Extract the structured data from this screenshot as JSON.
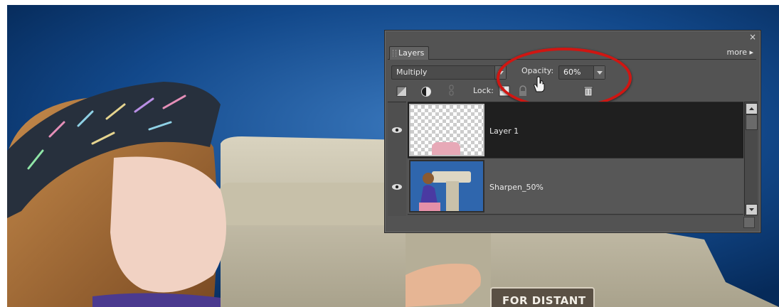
{
  "panel": {
    "close_glyph": "×",
    "tab_label": "Layers",
    "more_label": "more ▸",
    "blend_mode": "Multiply",
    "opacity_label": "Opacity:",
    "opacity_value": "60%",
    "lock_label": "Lock:",
    "highlight_color": "#d01612"
  },
  "layers": [
    {
      "name": "Layer 1",
      "selected": true,
      "visible": true
    },
    {
      "name": "Sharpen_50%",
      "selected": false,
      "visible": true
    }
  ],
  "background_sign": "FOR DISTANT",
  "colors": {
    "panel_bg": "#535353",
    "selected_row": "#1f1f1f",
    "sky": "#0c3f7e"
  }
}
